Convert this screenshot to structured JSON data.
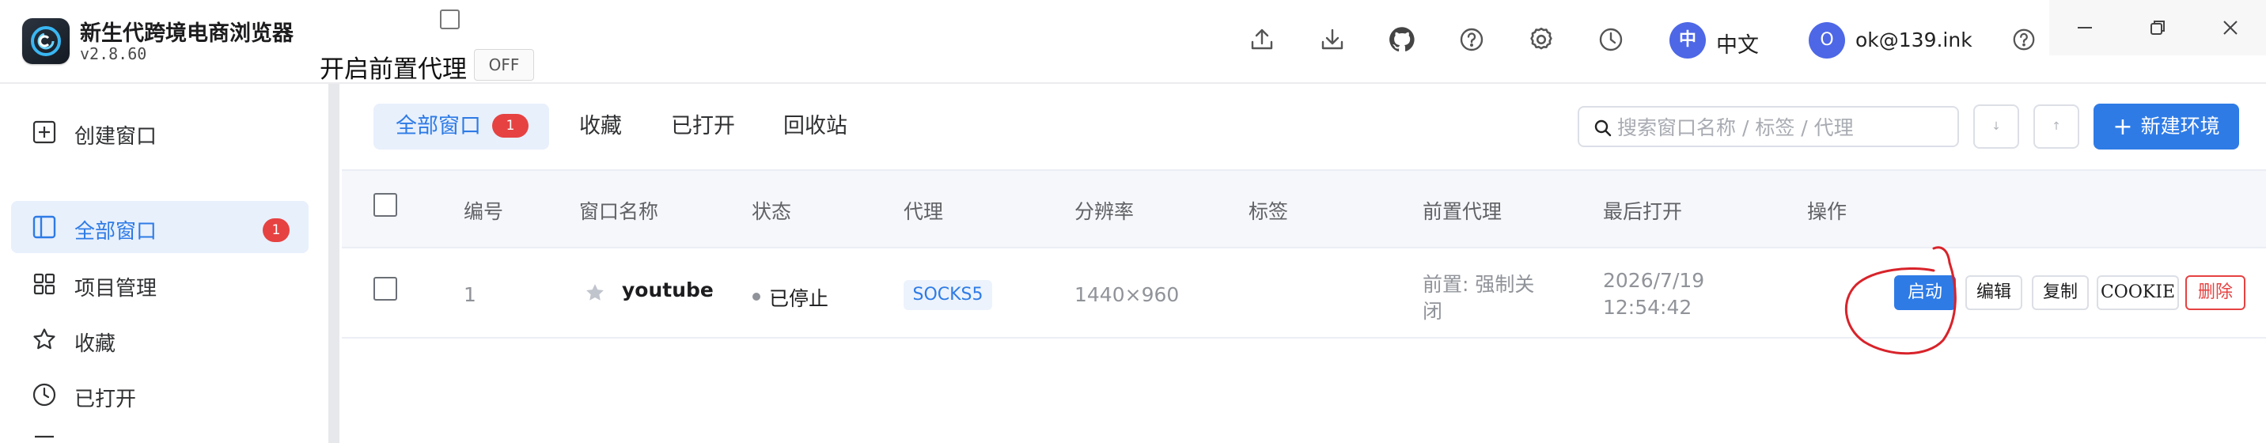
{
  "app": {
    "title": "新生代跨境电商浏览器",
    "version": "v2.8.60",
    "proxy_label": "开启前置代理",
    "proxy_toggle": "OFF"
  },
  "toolbar": {
    "icons": [
      "upload-icon",
      "download-icon",
      "github-icon",
      "help-icon",
      "settings-icon",
      "history-icon"
    ],
    "language_badge": "中",
    "language_label": "中文",
    "user_badge": "O",
    "user_email": "ok@139.ink",
    "help_icon": "help-icon"
  },
  "window_controls": [
    "minimize-icon",
    "restore-icon",
    "close-icon"
  ],
  "sidebar": {
    "create_label": "创建窗口",
    "items": [
      {
        "label": "全部窗口",
        "badge": "1",
        "icon": "layout-icon"
      },
      {
        "label": "项目管理",
        "icon": "grid-icon"
      },
      {
        "label": "收藏",
        "icon": "star-icon"
      },
      {
        "label": "已打开",
        "icon": "clock-icon"
      }
    ]
  },
  "tabs": [
    {
      "label": "全部窗口",
      "badge": "1"
    },
    {
      "label": "收藏"
    },
    {
      "label": "已打开"
    },
    {
      "label": "回收站"
    }
  ],
  "search": {
    "placeholder": "搜索窗口名称 / 标签 / 代理"
  },
  "sort_buttons": [
    "↓",
    "↑"
  ],
  "new_env_label": "新建环境",
  "table": {
    "columns": [
      "编号",
      "窗口名称",
      "状态",
      "代理",
      "分辨率",
      "标签",
      "前置代理",
      "最后打开",
      "操作"
    ],
    "rows": [
      {
        "id": "1",
        "name": "youtube",
        "status": "已停止",
        "proxy": "SOCKS5",
        "resolution": "1440×960",
        "tag": "",
        "pre_proxy_line1": "前置: 强制关",
        "pre_proxy_line2": "闭",
        "last_open_date": "2026/7/19",
        "last_open_time": "12:54:42",
        "actions": {
          "start": "启动",
          "edit": "编辑",
          "copy": "复制",
          "cookie": "COOKIE",
          "delete": "删除"
        }
      }
    ]
  },
  "colors": {
    "accent": "#2e7be6",
    "danger": "#e64242",
    "badge": "#4d67e6",
    "annotation": "#d8232a"
  }
}
